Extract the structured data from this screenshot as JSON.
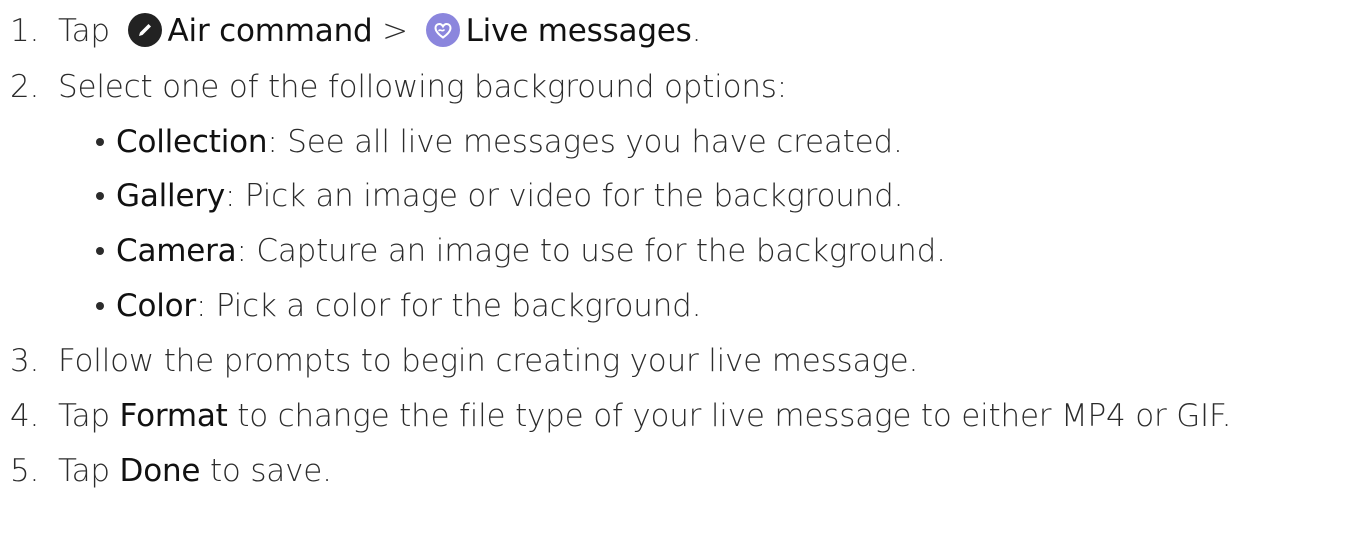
{
  "steps": [
    {
      "num": "1.",
      "text_before": "Tap",
      "icon1": "pen-icon",
      "bold1": "Air command",
      "sep": ">",
      "icon2": "heart-icon",
      "bold2": "Live messages",
      "text_after": "."
    },
    {
      "num": "2.",
      "text": "Select one of the following background options:"
    },
    {
      "num": "3.",
      "text": "Follow the prompts to begin creating your live message."
    },
    {
      "num": "4.",
      "text_before": "Tap",
      "bold": "Format",
      "text_after": "to change the file type of your live message to either MP4 or GIF."
    },
    {
      "num": "5.",
      "text_before": "Tap",
      "bold": "Done",
      "text_after": "to save."
    }
  ],
  "options": [
    {
      "label": "Collection",
      "desc": ": See all live messages you have created."
    },
    {
      "label": "Gallery",
      "desc": ": Pick an image or video for the background."
    },
    {
      "label": "Camera",
      "desc": ": Capture an image to use for the background."
    },
    {
      "label": "Color",
      "desc": ": Pick a color for the background."
    }
  ],
  "colors": {
    "text": "#2b2b2b",
    "pen_icon_bg": "#222222",
    "heart_icon_bg": "#8b86dd"
  }
}
